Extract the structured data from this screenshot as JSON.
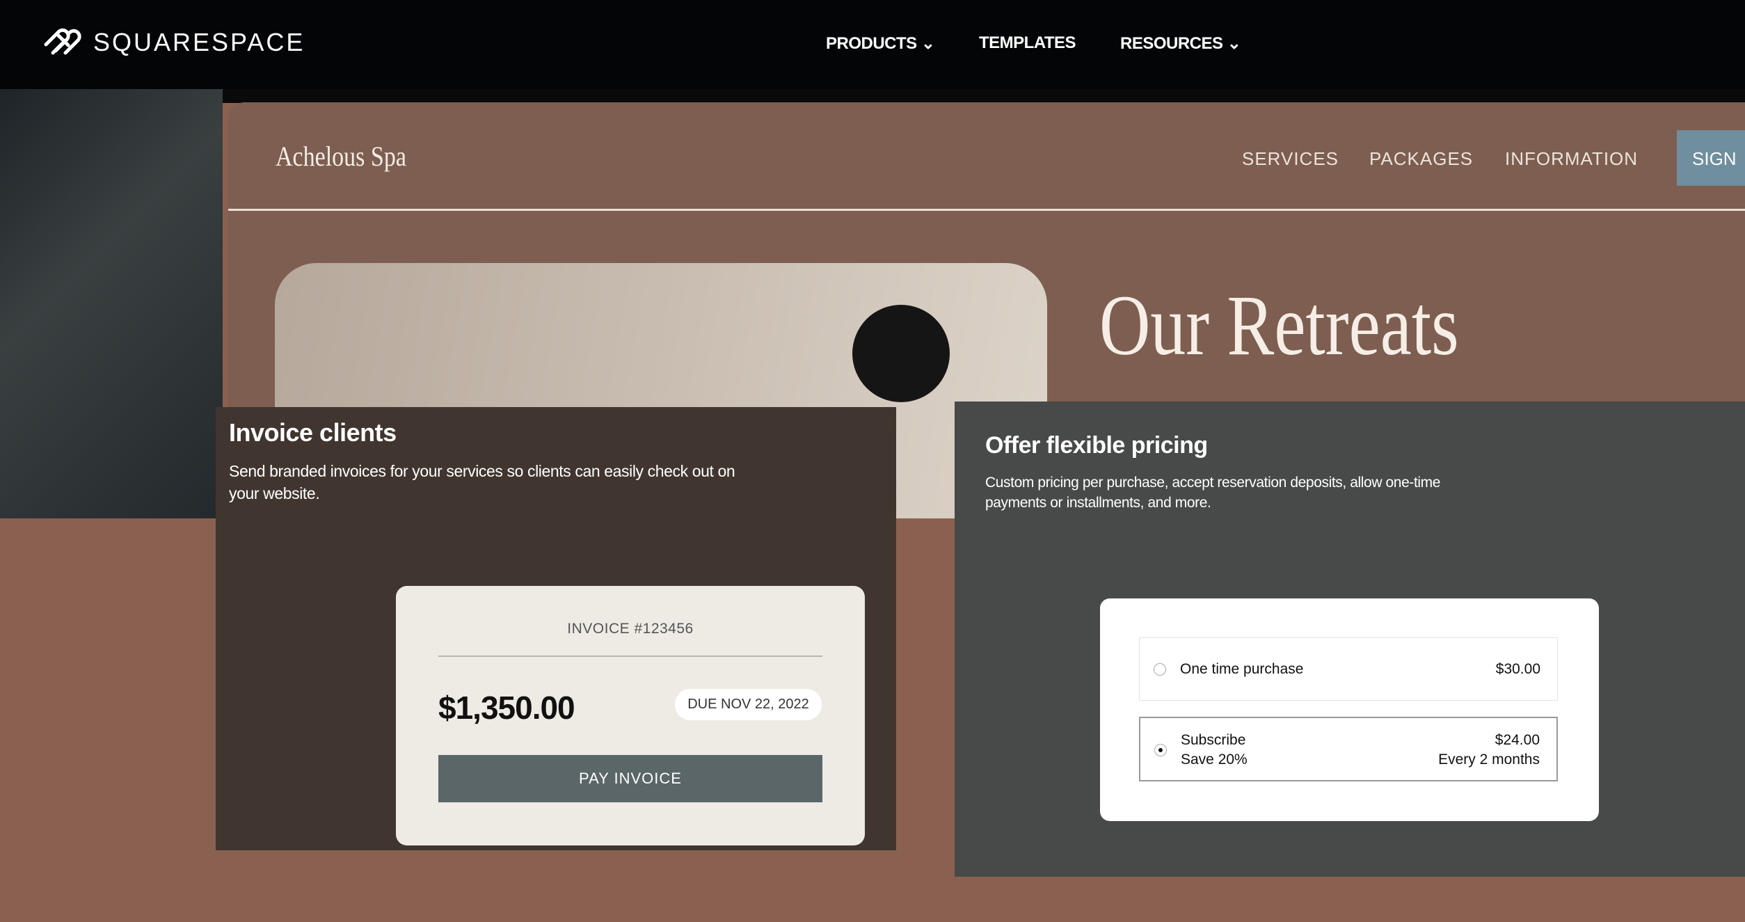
{
  "topnav": {
    "brand": "SQUARESPACE",
    "items": [
      {
        "label": "PRODUCTS",
        "dropdown": true
      },
      {
        "label": "TEMPLATES",
        "dropdown": false
      },
      {
        "label": "RESOURCES",
        "dropdown": true
      }
    ]
  },
  "spa": {
    "brand": "Achelous Spa",
    "nav": [
      "SERVICES",
      "PACKAGES",
      "INFORMATION"
    ],
    "sign_label": "SIGN",
    "headline": "Our Retreats"
  },
  "invoice": {
    "title": "Invoice clients",
    "description": "Send branded invoices for your services so clients can easily check out on your website.",
    "card": {
      "number": "INVOICE #123456",
      "amount": "$1,350.00",
      "due": "DUE NOV 22, 2022",
      "pay_label": "PAY INVOICE"
    }
  },
  "pricing": {
    "title": "Offer flexible pricing",
    "description": "Custom pricing per purchase, accept reservation deposits, allow one-time payments or installments, and more.",
    "options": [
      {
        "label": "One time purchase",
        "price": "$30.00",
        "selected": false
      },
      {
        "label": "Subscribe",
        "sublabel": "Save 20%",
        "price": "$24.00",
        "interval": "Every 2 months",
        "selected": true
      }
    ]
  },
  "colors": {
    "nav_bg": "#030507",
    "spa_bg": "#7d5e50",
    "invoice_bg": "#40362f",
    "pricing_bg": "#474a48",
    "pay_button": "#5a6668",
    "sign_button": "#6f8e9e"
  }
}
